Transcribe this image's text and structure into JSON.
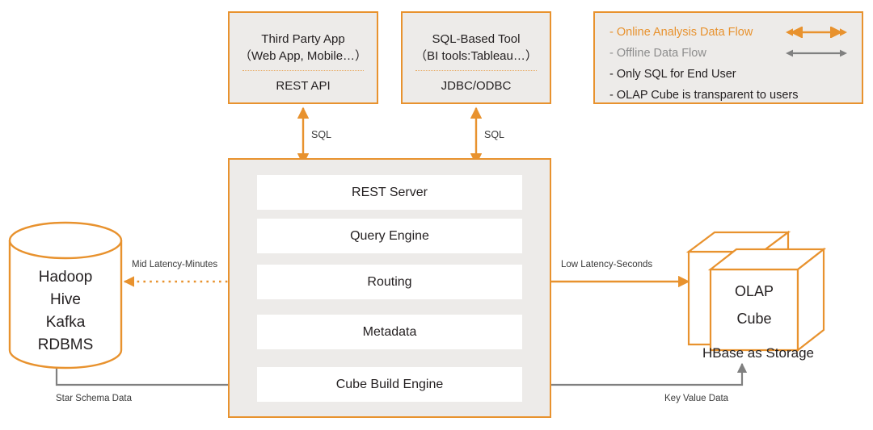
{
  "colors": {
    "orange": "#E8922E",
    "panel_fill": "#EDEBE9",
    "gray_arrow": "#808080",
    "box_fill": "#FFFFFF",
    "text": "#231f20",
    "legend_gray_text": "#8d8d8d"
  },
  "clients": [
    {
      "name": "third-party-app",
      "title_line1": "Third Party App",
      "title_line2": "（Web App, Mobile…）",
      "protocol": "REST API"
    },
    {
      "name": "sql-based-tool",
      "title_line1": "SQL-Based Tool",
      "title_line2": "（BI tools:Tableau…）",
      "protocol": "JDBC/ODBC"
    }
  ],
  "legend": {
    "items": [
      {
        "label": "- Online Analysis Data Flow",
        "style": "orange",
        "arrow": "double-arrow-orange"
      },
      {
        "label": "- Offline Data Flow",
        "style": "gray",
        "arrow": "double-arrow-gray"
      },
      {
        "label": "- Only SQL for End User",
        "style": "dark",
        "arrow": "none"
      },
      {
        "label": "- OLAP Cube is transparent to users",
        "style": "dark",
        "arrow": "none"
      }
    ]
  },
  "engine": {
    "layers": [
      "REST Server",
      "Query Engine",
      "Routing",
      "Metadata",
      "Cube Build Engine"
    ]
  },
  "source_store": {
    "name": "hadoop-cylinder",
    "lines": [
      "Hadoop",
      "Hive",
      "Kafka",
      "RDBMS"
    ]
  },
  "cube_store": {
    "name": "olap-cube",
    "lines": [
      "OLAP",
      "Cube"
    ],
    "caption": "HBase  as Storage"
  },
  "connectors": {
    "sql_left": "SQL",
    "sql_right": "SQL",
    "mid_latency": "Mid Latency-Minutes",
    "low_latency": "Low Latency-Seconds",
    "star_schema": "Star Schema Data",
    "key_value": "Key Value Data"
  }
}
